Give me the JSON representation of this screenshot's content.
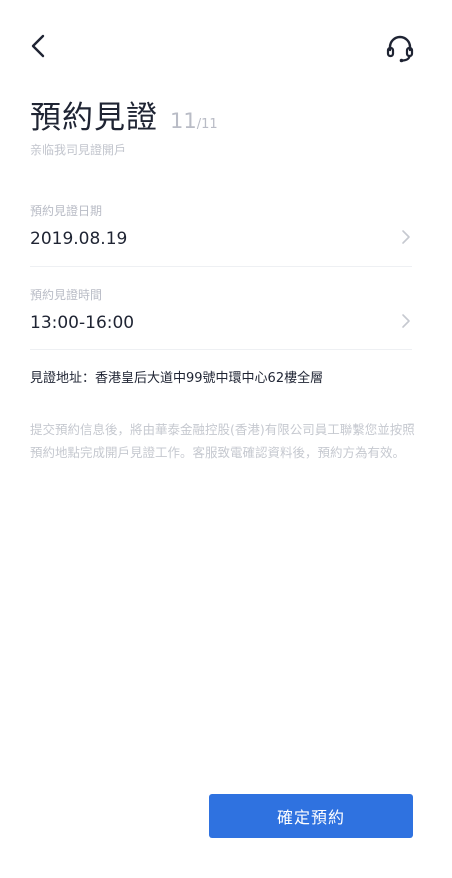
{
  "header": {
    "back_icon": "chevron-left-icon",
    "support_icon": "headset-icon"
  },
  "page": {
    "title": "預約見證",
    "step_current": "11",
    "step_total": "/11",
    "subtitle": "亲临我司見證開戶"
  },
  "form": {
    "date": {
      "label": "預約見證日期",
      "value": "2019.08.19"
    },
    "time": {
      "label": "預約見證時間",
      "value": "13:00-16:00"
    },
    "address": "見證地址：香港皇后大道中99號中環中心62樓全層",
    "notice": "提交預約信息後，將由華泰金融控股(香港)有限公司員工聯繫您並按照預約地點完成開戶見證工作。客服致電確認資料後，預約方為有效。"
  },
  "actions": {
    "confirm_label": "確定預約"
  },
  "colors": {
    "primary": "#2f72e0",
    "text": "#1f2433",
    "muted": "#b9bcc6"
  }
}
